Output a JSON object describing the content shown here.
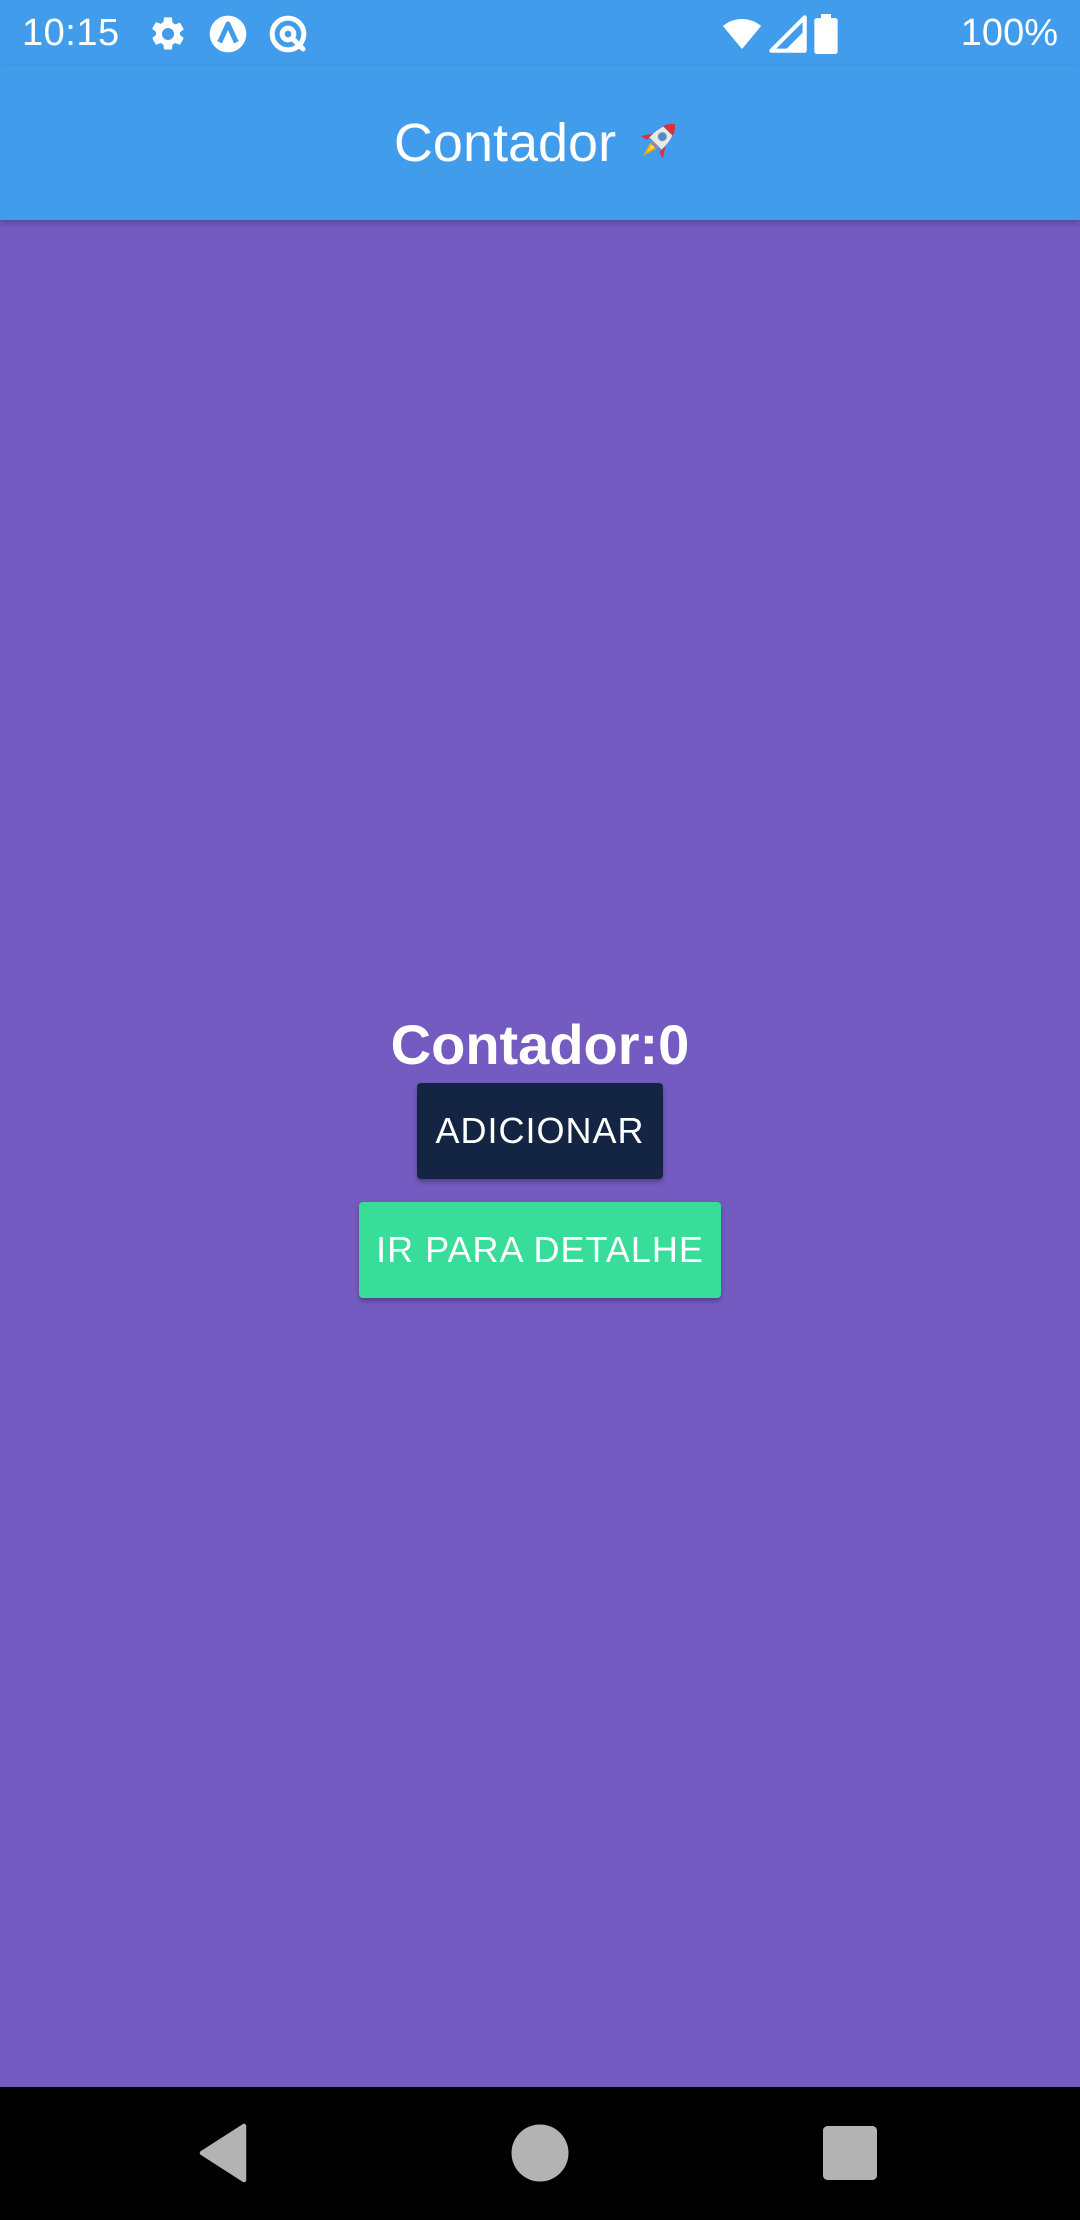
{
  "status_bar": {
    "time": "10:15",
    "battery": "100%",
    "icons": [
      "gear-icon",
      "app-a-icon",
      "app-at-icon",
      "wifi-icon",
      "signal-icon",
      "battery-icon"
    ]
  },
  "app_bar": {
    "title": "Contador",
    "title_icon": "rocket-icon"
  },
  "main": {
    "counter_text": "Contador:0",
    "add_button_label": "ADICIONAR",
    "detail_button_label": "IR PARA DETALHE"
  },
  "nav_bar": {
    "buttons": [
      "back-icon",
      "home-icon",
      "recents-icon"
    ]
  },
  "colors": {
    "app_bar": "#419ceb",
    "background": "#745bc1",
    "add_button": "#132542",
    "detail_button": "#39dd9a"
  }
}
